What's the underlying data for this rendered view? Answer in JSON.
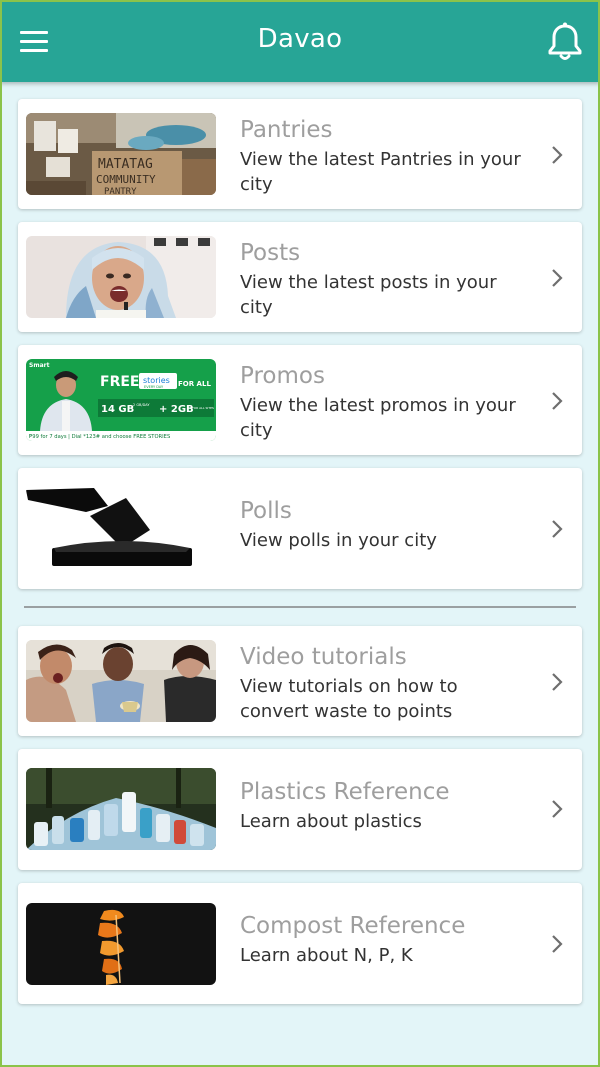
{
  "app_bar": {
    "title": "Davao",
    "menu_icon": "hamburger-menu-icon",
    "notification_icon": "bell-icon",
    "color": "#27a596"
  },
  "cards": [
    {
      "title": "Pantries",
      "subtitle": "View the latest Pantries in your city",
      "thumb": "pantry-photo"
    },
    {
      "title": "Posts",
      "subtitle": "View the latest posts in your city",
      "thumb": "woman-hijab-photo"
    },
    {
      "title": "Promos",
      "subtitle": "View the latest promos in your city",
      "thumb": "smart-promo-banner",
      "promo": {
        "brand": "Smart",
        "free": "FREE",
        "stories": "stories",
        "every_day": "EVERY DAY",
        "for_all": "FOR ALL",
        "gb1": "14 GB",
        "per_day": "2 GB/DAY",
        "gb2": "+ 2GB",
        "for_all_sites": "FOR ALL SITES",
        "footer": "₱99 for 7 days  |  Dial *123# and choose FREE STORIES"
      }
    },
    {
      "title": "Polls",
      "subtitle": "View polls in your city",
      "thumb": "ballot-box-icon"
    },
    {
      "title": "Video tutorials",
      "subtitle": "View tutorials on how to convert waste to points",
      "thumb": "kids-tutorial-photo"
    },
    {
      "title": "Plastics Reference",
      "subtitle": "Learn about plastics",
      "thumb": "plastic-bottles-photo"
    },
    {
      "title": "Compost Reference",
      "subtitle": "Learn about N, P, K",
      "thumb": "orange-peel-photo"
    }
  ],
  "pantry_sign": {
    "line1": "MATATAG",
    "line2": "COMMUNITY",
    "line3": "PANTRY"
  },
  "chevron_icon": "chevron-right-icon"
}
